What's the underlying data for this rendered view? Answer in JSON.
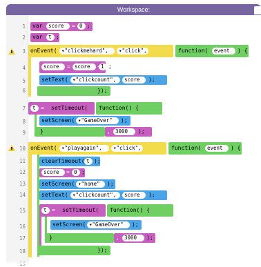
{
  "header": {
    "title": "Workspace:"
  },
  "line_numbers": [
    "1",
    "2",
    "3",
    "4",
    "5",
    "6",
    "7",
    "8",
    "9",
    "10",
    "11",
    "12",
    "13",
    "14",
    "15",
    "16",
    "17",
    "18",
    "19"
  ],
  "code": {
    "l1": {
      "kw": "var",
      "name": "score",
      "eq": "=",
      "val": "0",
      "semi": ";"
    },
    "l2": {
      "kw": "var",
      "name": "t",
      "semi": ";"
    },
    "l3": {
      "fn": "onEvent(",
      "arg1": "▾\"clickmehard\",",
      "arg2": "▾\"click\",",
      "fnkw": "function(",
      "param": "event",
      "close": ") {"
    },
    "l4": {
      "name": "score",
      "eq": "=",
      "name2": "score",
      "op": "+",
      "val": "1",
      "semi": ";"
    },
    "l5": {
      "fn": "setText(",
      "arg1": "▾\"clickcount\",",
      "arg2": "score",
      "close": ");"
    },
    "l6": {
      "close": "});"
    },
    "l7": {
      "name": "t",
      "eq": "=",
      "fn": "setTimeout(",
      "fnkw": "function() {"
    },
    "l8": {
      "fn": "setScreen(",
      "arg1": "▾\"GameOver\"",
      "close": ");"
    },
    "l9": {
      "close": "}",
      "comma": ",",
      "val": "3000",
      "end": ");"
    },
    "l10": {
      "fn": "onEvent(",
      "arg1": "▾\"playagain\",",
      "arg2": "▾\"click\",",
      "fnkw": "function(",
      "param": "event",
      "close": ") {"
    },
    "l11": {
      "fn": "clearTimeout(",
      "arg1": "t",
      "close": ");"
    },
    "l12": {
      "name": "score",
      "eq": "=",
      "val": "0",
      "semi": ";"
    },
    "l13": {
      "fn": "setScreen(",
      "arg1": "▾\"home\"",
      "close": ");"
    },
    "l14": {
      "fn": "setText(",
      "arg1": "▾\"clickcount\",",
      "arg2": "score",
      "close": ");"
    },
    "l15": {
      "name": "t",
      "eq": "=",
      "fn": "setTimeout(",
      "fnkw": "function() {"
    },
    "l16": {
      "fn": "setScreen(",
      "arg1": "▾\"GameOver\"",
      "close": ");"
    },
    "l17": {
      "close": "}",
      "comma": ",",
      "val": "3000",
      "end": ");"
    },
    "l18": {
      "close": "});"
    }
  },
  "colors": {
    "variable": "#c75fc0",
    "event": "#f2dc4c",
    "function": "#6fcf63",
    "ui": "#4aa4e8",
    "header": "#7665a0",
    "warning": "#f4cc34"
  },
  "icons": {
    "warning": "warning-triangle-icon",
    "dropdown": "dropdown-arrow-icon"
  }
}
